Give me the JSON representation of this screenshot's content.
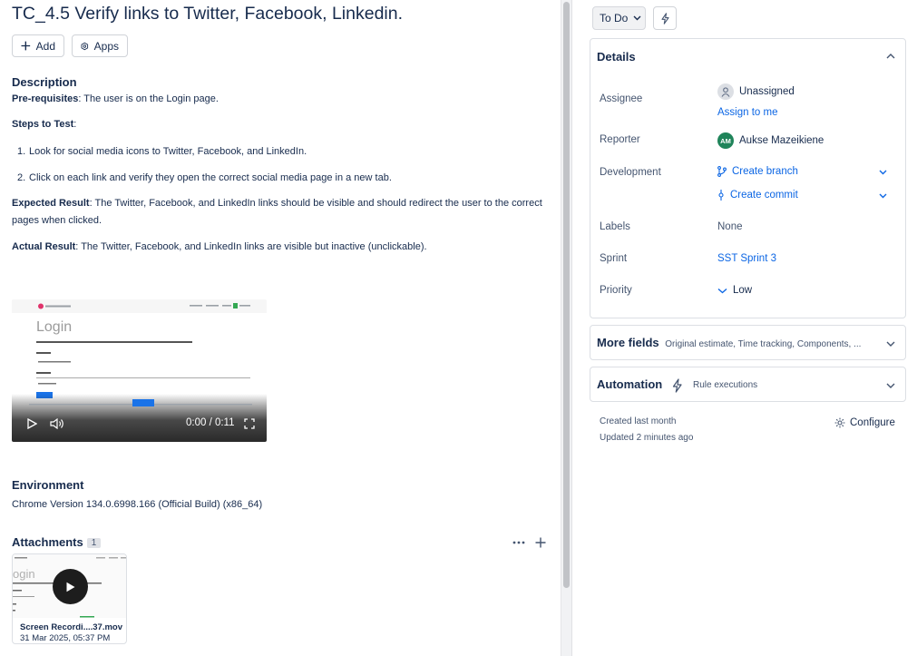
{
  "issue": {
    "title": "TC_4.5 Verify links to Twitter, Facebook, Linkedin.",
    "add_label": "Add",
    "apps_label": "Apps"
  },
  "description": {
    "heading": "Description",
    "prereq_label": "Pre-requisites",
    "prereq_text": ": The user is on the Login page.",
    "steps_label": "Steps to Test",
    "steps_colon": ":",
    "steps": [
      "Look for social media icons to Twitter, Facebook, and LinkedIn.",
      "Click on each link and verify they open the correct social media page in a new tab."
    ],
    "expected_label": "Expected Result",
    "expected_text": ": The Twitter, Facebook, and LinkedIn links should be visible and should redirect the user to the correct pages when clicked.",
    "actual_label": "Actual Result",
    "actual_text": ": The Twitter, Facebook, and LinkedIn links are visible but inactive (unclickable)."
  },
  "video": {
    "login_heading": "Login",
    "time": "0:00 / 0:11"
  },
  "environment": {
    "heading": "Environment",
    "text": "Chrome Version 134.0.6998.166 (Official Build) (x86_64)"
  },
  "attachments": {
    "heading": "Attachments",
    "count": "1",
    "thumb_login": "ogin",
    "file_name": "Screen Recordi....37.mov",
    "file_date": "31 Mar 2025, 05:37 PM"
  },
  "sidebar": {
    "status": "To Do",
    "details_title": "Details",
    "fields": {
      "assignee_label": "Assignee",
      "assignee_value": "Unassigned",
      "assign_to_me": "Assign to me",
      "reporter_label": "Reporter",
      "reporter_initials": "AM",
      "reporter_value": "Aukse Mazeikiene",
      "development_label": "Development",
      "create_branch": "Create branch",
      "create_commit": "Create commit",
      "labels_label": "Labels",
      "labels_value": "None",
      "sprint_label": "Sprint",
      "sprint_value": "SST Sprint 3",
      "priority_label": "Priority",
      "priority_value": "Low"
    },
    "more_fields_title": "More fields",
    "more_fields_hint": "Original estimate, Time tracking, Components, ...",
    "automation_title": "Automation",
    "automation_hint": "Rule executions",
    "created": "Created last month",
    "updated": "Updated 2 minutes ago",
    "configure": "Configure"
  },
  "colors": {
    "link": "#0c66e4",
    "text": "#172b4d",
    "reporter_avatar": "#1f845a"
  }
}
